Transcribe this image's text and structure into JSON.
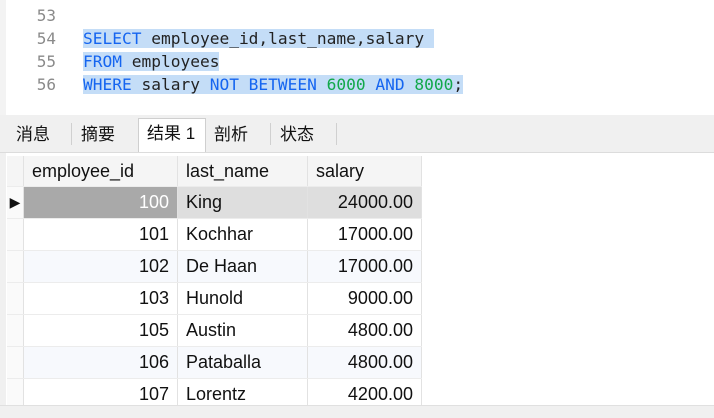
{
  "editor": {
    "lines": [
      {
        "num": "53",
        "text": ""
      },
      {
        "num": "54"
      },
      {
        "num": "55"
      },
      {
        "num": "56"
      }
    ],
    "line54": {
      "kw": "SELECT",
      "rest": " employee_id,last_name,salary "
    },
    "line55": {
      "kw": "FROM",
      "rest": " employees"
    },
    "line56": {
      "kw1": "WHERE",
      "mid1": " salary ",
      "kw2": "NOT BETWEEN",
      "sp1": " ",
      "n1": "6000",
      "sp2": " ",
      "kw3": "AND",
      "sp3": " ",
      "n2": "8000",
      "end": ";"
    }
  },
  "tabs": [
    "消息",
    "摘要",
    "结果 1",
    "剖析",
    "状态"
  ],
  "active_tab": "结果 1",
  "result": {
    "columns": [
      "employee_id",
      "last_name",
      "salary"
    ],
    "rows": [
      {
        "id": "100",
        "name": "King",
        "salary": "24000.00"
      },
      {
        "id": "101",
        "name": "Kochhar",
        "salary": "17000.00"
      },
      {
        "id": "102",
        "name": "De Haan",
        "salary": "17000.00"
      },
      {
        "id": "103",
        "name": "Hunold",
        "salary": "9000.00"
      },
      {
        "id": "105",
        "name": "Austin",
        "salary": "4800.00"
      },
      {
        "id": "106",
        "name": "Pataballa",
        "salary": "4800.00"
      },
      {
        "id": "107",
        "name": "Lorentz",
        "salary": "4200.00"
      }
    ],
    "current_row_marker": "▶"
  },
  "colors": {
    "keyword": "#1565f0",
    "number": "#12a84a",
    "selection": "#c4ddf7"
  }
}
